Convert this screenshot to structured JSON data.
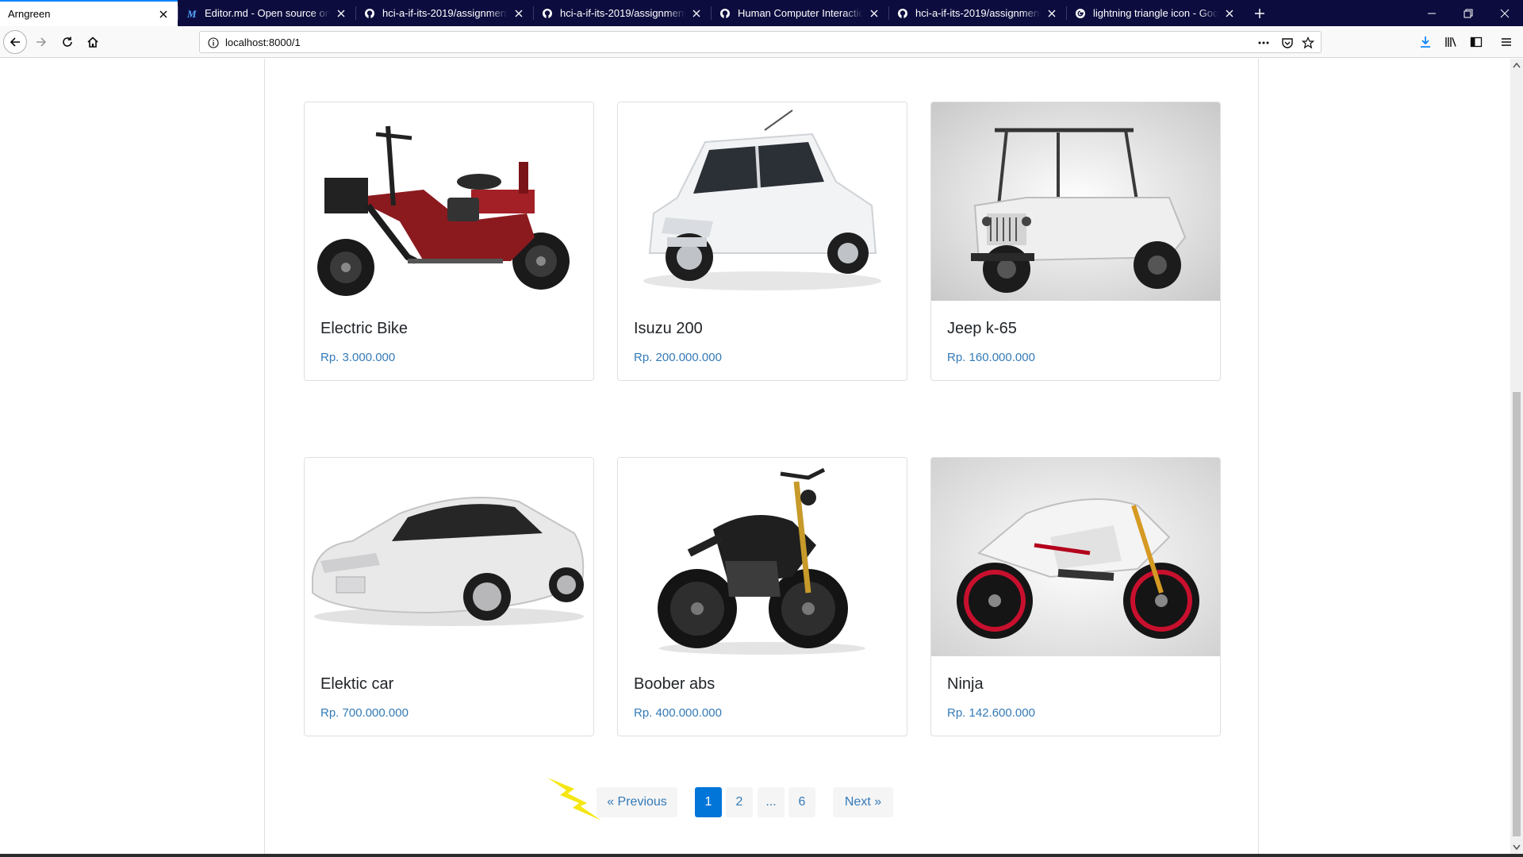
{
  "browser": {
    "tabs": [
      {
        "title": "Arngreen",
        "icon": "none",
        "active": true
      },
      {
        "title": "Editor.md - Open source online",
        "icon": "editor-md-icon",
        "active": false
      },
      {
        "title": "hci-a-if-its-2019/assignment-3",
        "icon": "github-icon",
        "active": false
      },
      {
        "title": "hci-a-if-its-2019/assignment-3",
        "icon": "github-icon",
        "active": false
      },
      {
        "title": "Human Computer Interaction",
        "icon": "github-icon",
        "active": false
      },
      {
        "title": "hci-a-if-its-2019/assignment-3",
        "icon": "github-icon",
        "active": false
      },
      {
        "title": "lightning triangle icon - Google",
        "icon": "google-icon",
        "active": false
      }
    ],
    "url": "localhost:8000/1",
    "accent_color": "#0a84ff",
    "tabbar_color": "#0c0c3f"
  },
  "products": [
    {
      "name": "Electric Bike",
      "price": "Rp. 3.000.000",
      "image": "electric-bike-image"
    },
    {
      "name": "Isuzu 200",
      "price": "Rp. 200.000.000",
      "image": "white-hatchback-image"
    },
    {
      "name": "Jeep k-65",
      "price": "Rp. 160.000.000",
      "image": "white-jeep-image"
    },
    {
      "name": "Elektic car",
      "price": "Rp. 700.000.000",
      "image": "white-sedan-image"
    },
    {
      "name": "Boober abs",
      "price": "Rp. 400.000.000",
      "image": "black-motorcycle-image"
    },
    {
      "name": "Ninja",
      "price": "Rp. 142.600.000",
      "image": "white-sportbike-image"
    }
  ],
  "pagination": {
    "previous": "« Previous",
    "pages": [
      "1",
      "2",
      "...",
      "6"
    ],
    "current": "1",
    "next": "Next »",
    "link_color": "#337ab7",
    "active_color": "#0275d8"
  },
  "cursor": {
    "icon": "lightning-cursor-icon",
    "color": "#f5e614"
  }
}
